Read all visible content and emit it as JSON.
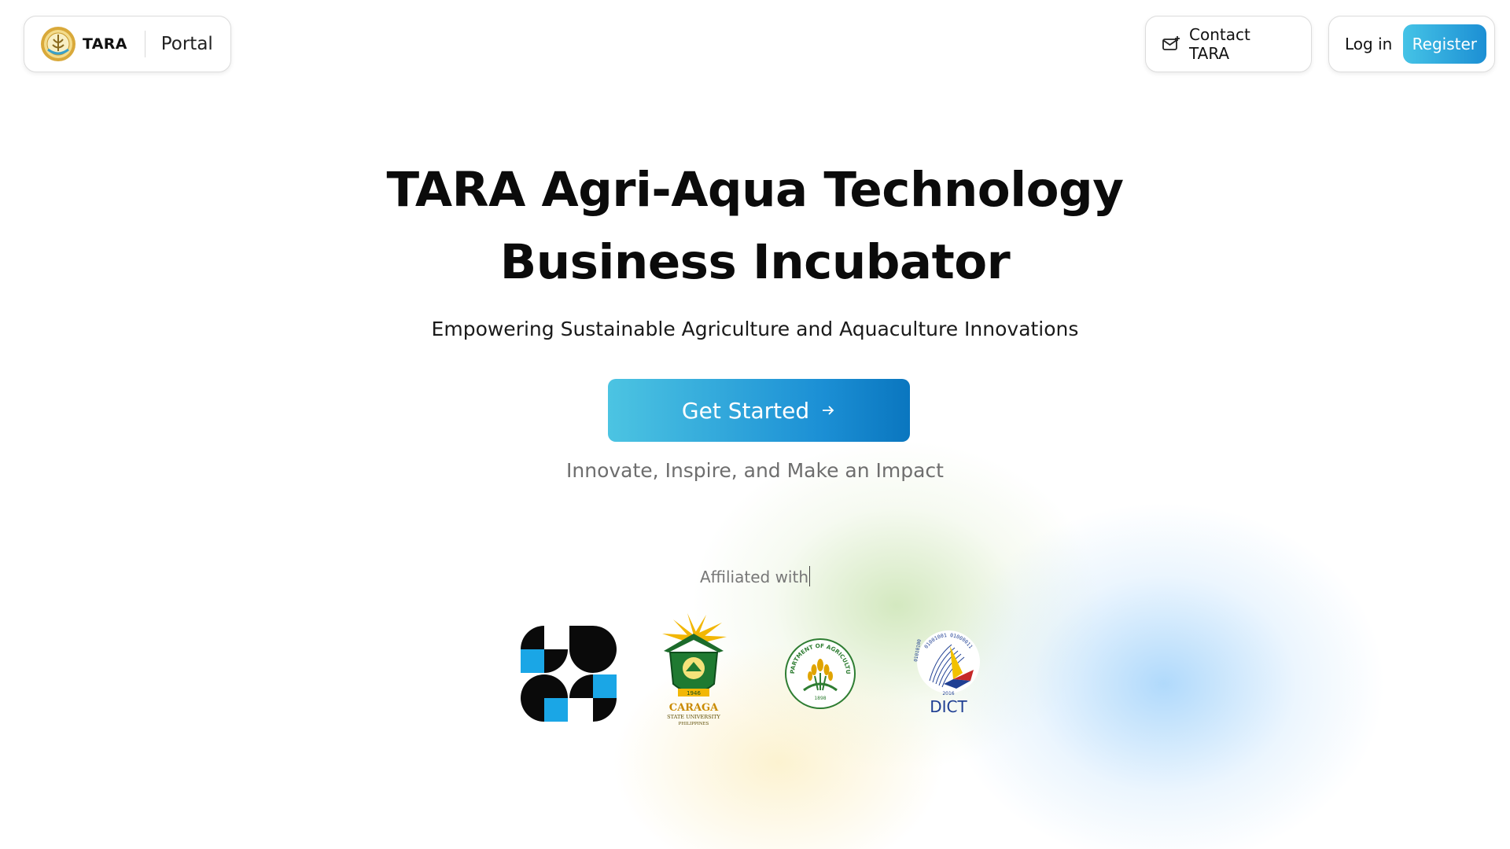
{
  "header": {
    "brand_name": "TARA",
    "portal_label": "Portal",
    "contact_label": "Contact TARA",
    "login_label": "Log in",
    "register_label": "Register"
  },
  "hero": {
    "title_line1": "TARA Agri-Aqua Technology",
    "title_line2": "Business Incubator",
    "subtitle": "Empowering Sustainable Agriculture and Aquaculture Innovations",
    "cta_label": "Get Started",
    "tagline": "Innovate, Inspire, and Make an Impact"
  },
  "affiliations": {
    "label": "Affiliated with",
    "logos": [
      {
        "name": "dost-logo"
      },
      {
        "name": "caraga-state-university-logo",
        "text": "CARAGA",
        "subtext": "STATE UNIVERSITY",
        "subtext2": "PHILIPPINES",
        "year": "1946"
      },
      {
        "name": "department-of-agriculture-logo",
        "text": "DEPARTMENT OF AGRICULTURE",
        "year": "1898"
      },
      {
        "name": "dict-logo",
        "text": "DICT",
        "year": "2016",
        "binary_top": "01001001 01000011",
        "binary_side": "01010100"
      }
    ]
  },
  "icons": {
    "mail": "mail-plus-icon",
    "arrow": "arrow-right-icon",
    "brand": "tara-seal-icon"
  },
  "colors": {
    "accent_start": "#45c3e6",
    "accent_end": "#1c8fd4",
    "text_dark": "#0b0b0b",
    "text_muted": "#6e6e6e"
  }
}
